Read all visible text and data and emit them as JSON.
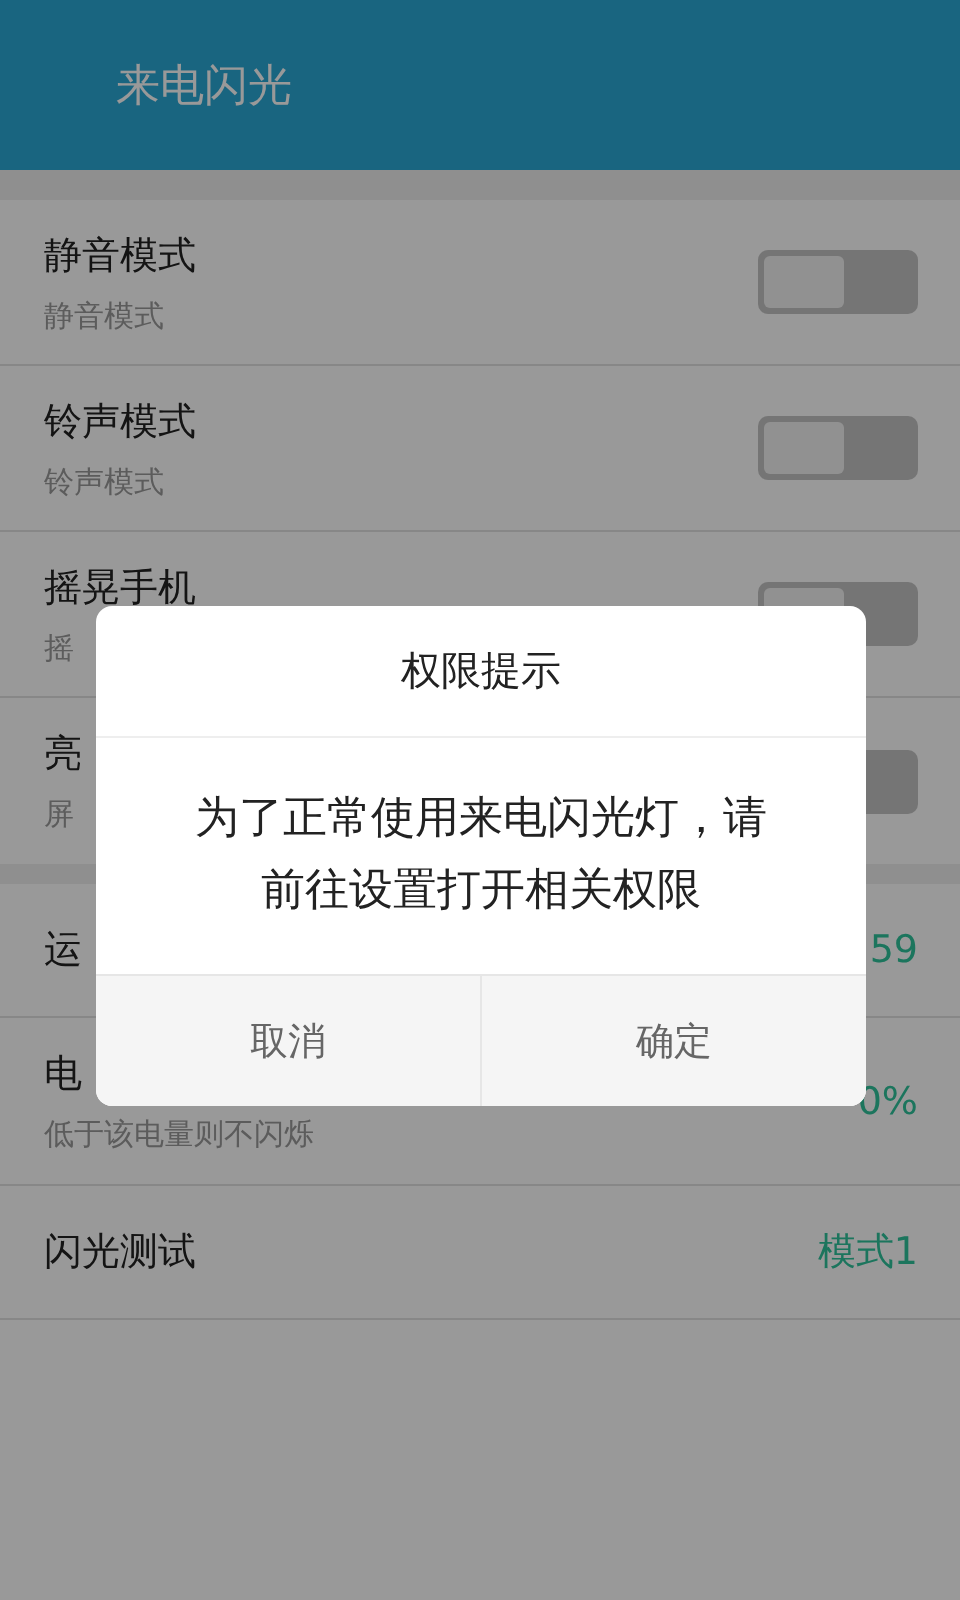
{
  "app_bar": {
    "title": "来电闪光"
  },
  "switch_rows": [
    {
      "title": "静音模式",
      "subtitle": "静音模式",
      "on": false
    },
    {
      "title": "铃声模式",
      "subtitle": "铃声模式",
      "on": false
    },
    {
      "title": "摇晃手机",
      "subtitle": "摇",
      "on": false
    },
    {
      "title": "亮",
      "subtitle": "屏",
      "on": false
    }
  ],
  "value_rows": [
    {
      "title": "运",
      "value": "59"
    },
    {
      "title": "电",
      "subtitle": "低于该电量则不闪烁",
      "value": "0%"
    },
    {
      "title": "闪光测试",
      "value": "模式1"
    }
  ],
  "dialog": {
    "title": "权限提示",
    "message": "为了正常使用来电闪光灯，请前往设置打开相关权限",
    "buttons": [
      "取消",
      "确定"
    ]
  }
}
